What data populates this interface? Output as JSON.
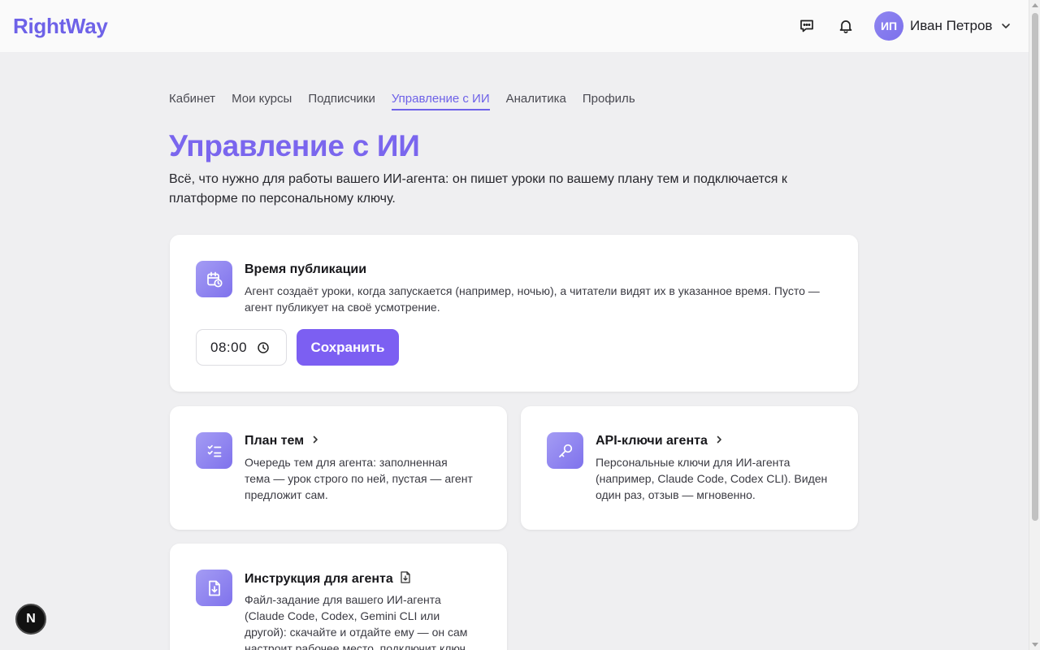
{
  "header": {
    "logo": "RightWay",
    "user": {
      "initials": "ИП",
      "name": "Иван Петров"
    }
  },
  "nav": {
    "items": [
      "Кабинет",
      "Мои курсы",
      "Подписчики",
      "Управление с ИИ",
      "Аналитика",
      "Профиль"
    ],
    "active_index": 3
  },
  "page": {
    "title": "Управление с ИИ",
    "subtitle_line1": "Всё, что нужно для работы вашего ИИ-агента: он пишет уроки по вашему плану тем и подключается к",
    "subtitle_line2": "платформе по персональному ключу."
  },
  "publish_card": {
    "title": "Время публикации",
    "desc_line1": "Агент создаёт уроки, когда запускается (например, ночью), а читатели видят их в указанное время. Пусто —",
    "desc_line2": "агент публикует на своё усмотрение.",
    "time_value": "08:00",
    "save_label": "Сохранить",
    "icon": "calendar-clock-icon"
  },
  "topics_card": {
    "title": "План тем",
    "desc_line1": "Очередь тем для агента: заполненная",
    "desc_line2": "тема — урок строго по ней, пустая — агент",
    "desc_line3": "предложит сам.",
    "icon": "checklist-icon"
  },
  "keys_card": {
    "title": "API-ключи агента",
    "desc_line1": "Персональные ключи для ИИ-агента",
    "desc_line2": "(например, Claude Code, Codex CLI). Виден",
    "desc_line3": "один раз, отзыв — мгновенно.",
    "icon": "key-icon"
  },
  "instr_card": {
    "title": "Инструкция для агента",
    "desc_line1": "Файл-задание для вашего ИИ-агента",
    "desc_line2": "(Claude Code, Codex, Gemini CLI или",
    "desc_line3": "другой): скачайте и отдайте ему — он сам",
    "desc_line4": "настроит рабочее место, подключит ключ",
    "icon": "file-download-icon"
  },
  "dev_badge": {
    "label": "N"
  },
  "colors": {
    "brand": "#6e62e8",
    "title_purple": "#7a66ee",
    "button": "#7c5ff2",
    "background": "#efeff1"
  }
}
